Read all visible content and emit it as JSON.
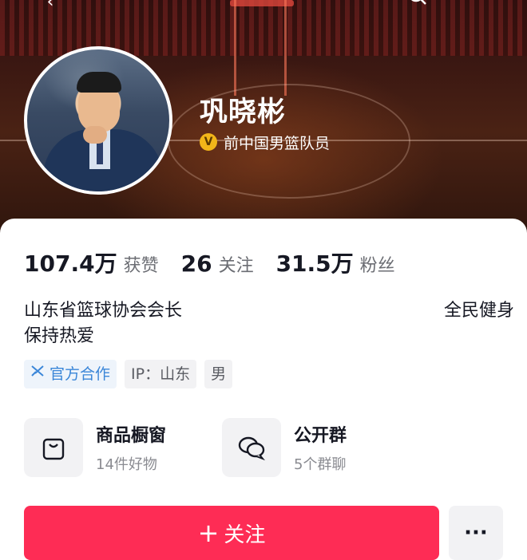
{
  "header": {
    "name": "巩晓彬",
    "verify_label": "前中国男篮队员",
    "verify_icon": "v-badge-icon",
    "accent": "#f2b619"
  },
  "stats": [
    {
      "value": "107.4万",
      "label": "获赞"
    },
    {
      "value": "26",
      "label": "关注"
    },
    {
      "value": "31.5万",
      "label": "粉丝"
    }
  ],
  "bio": {
    "line1": "山东省篮球协会会长",
    "line2": "保持热爱",
    "right": "全民健身"
  },
  "tags": [
    {
      "label": "官方合作",
      "icon": "official-icon"
    },
    {
      "label": "IP：山东"
    },
    {
      "label": "男"
    }
  ],
  "shortcuts": [
    {
      "title": "商品橱窗",
      "sub": "14件好物",
      "icon": "shopping-bag-icon"
    },
    {
      "title": "公开群",
      "sub": "5个群聊",
      "icon": "chat-bubbles-icon"
    }
  ],
  "actions": {
    "follow_label": "关注",
    "more_label": "···",
    "follow_color": "#fe2c55"
  }
}
